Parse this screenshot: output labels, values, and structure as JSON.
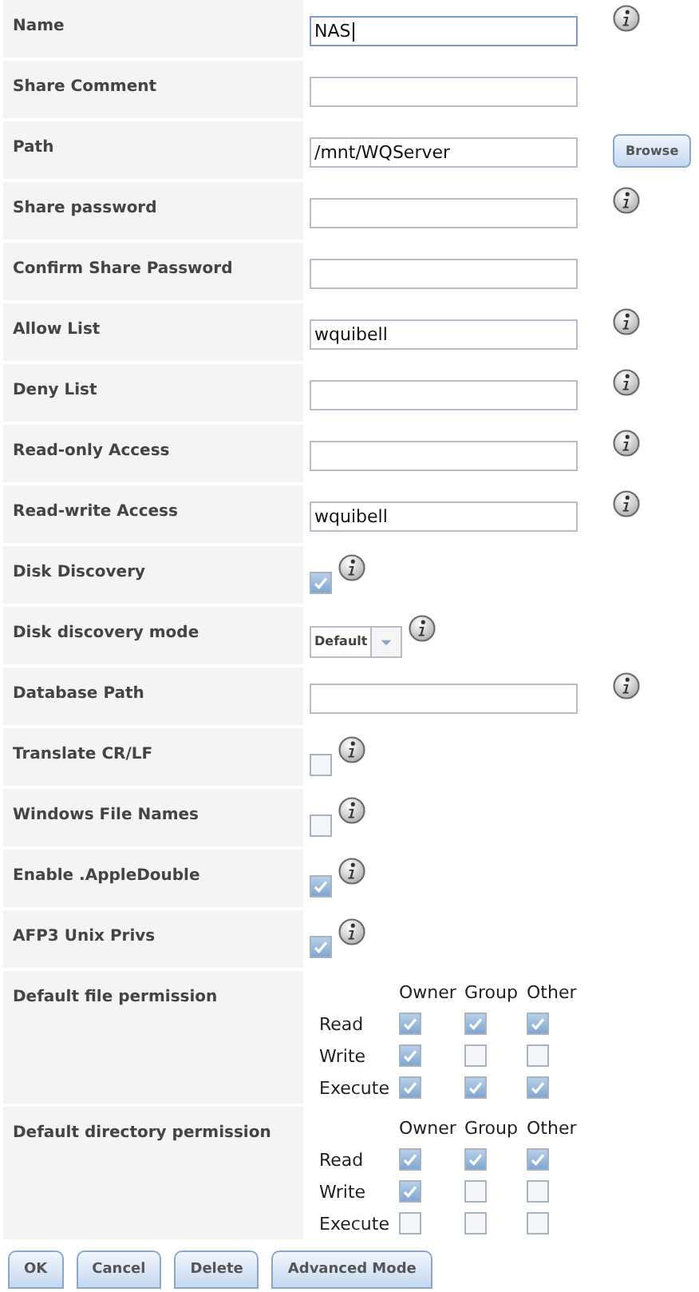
{
  "fields": [
    {
      "label": "Name",
      "kind": "text",
      "value": "NAS",
      "focused": true,
      "info": true
    },
    {
      "label": "Share Comment",
      "kind": "text"
    },
    {
      "label": "Path",
      "kind": "text",
      "value": "/mnt/WQServer",
      "button": "Browse"
    },
    {
      "label": "Share password",
      "kind": "text",
      "info": true
    },
    {
      "label": "Confirm Share Password",
      "kind": "text"
    },
    {
      "label": "Allow List",
      "kind": "text",
      "value": "wquibell",
      "info": true
    },
    {
      "label": "Deny List",
      "kind": "text",
      "info": true
    },
    {
      "label": "Read-only Access",
      "kind": "text",
      "info": true
    },
    {
      "label": "Read-write Access",
      "kind": "text",
      "value": "wquibell",
      "info": true
    },
    {
      "label": "Disk Discovery",
      "kind": "checkbox",
      "checked": true,
      "info": true
    },
    {
      "label": "Disk discovery mode",
      "kind": "select",
      "value": "Default",
      "info": true
    },
    {
      "label": "Database Path",
      "kind": "text",
      "info": true
    },
    {
      "label": "Translate CR/LF",
      "kind": "checkbox",
      "checked": false,
      "info": true
    },
    {
      "label": "Windows File Names",
      "kind": "checkbox",
      "checked": false,
      "info": true
    },
    {
      "label": "Enable .AppleDouble",
      "kind": "checkbox",
      "checked": true,
      "info": true
    },
    {
      "label": "AFP3 Unix Privs",
      "kind": "checkbox",
      "checked": true,
      "info": true
    },
    {
      "label": "Default file permission",
      "kind": "permissions",
      "columns": [
        "Owner",
        "Group",
        "Other"
      ],
      "rows": [
        {
          "label": "Read",
          "checks": [
            true,
            true,
            true
          ]
        },
        {
          "label": "Write",
          "checks": [
            true,
            false,
            false
          ]
        },
        {
          "label": "Execute",
          "checks": [
            true,
            true,
            true
          ]
        }
      ]
    },
    {
      "label": "Default directory permission",
      "kind": "permissions",
      "columns": [
        "Owner",
        "Group",
        "Other"
      ],
      "rows": [
        {
          "label": "Read",
          "checks": [
            true,
            true,
            true
          ]
        },
        {
          "label": "Write",
          "checks": [
            true,
            false,
            false
          ]
        },
        {
          "label": "Execute",
          "checks": [
            false,
            false,
            false
          ]
        }
      ]
    }
  ],
  "buttons": [
    "OK",
    "Cancel",
    "Delete",
    "Advanced Mode"
  ]
}
